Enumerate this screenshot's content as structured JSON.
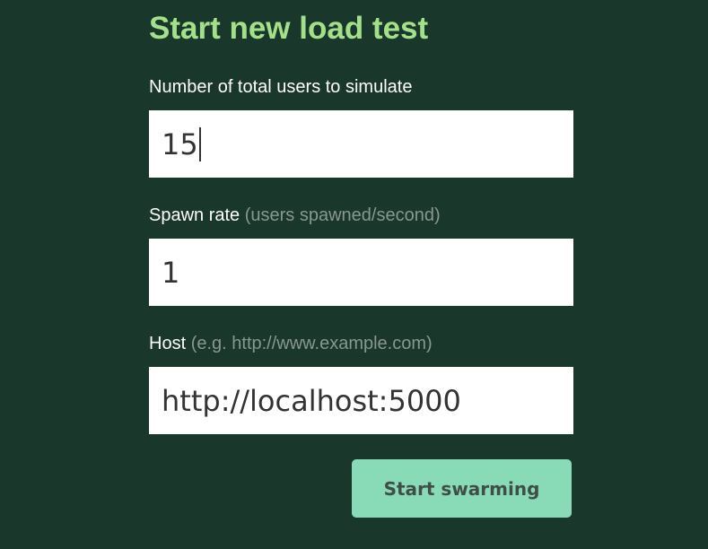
{
  "form": {
    "title": "Start new load test",
    "users": {
      "label": "Number of total users to simulate",
      "value": "15"
    },
    "spawn_rate": {
      "label": "Spawn rate",
      "hint": "(users spawned/second)",
      "value": "1"
    },
    "host": {
      "label": "Host",
      "hint": "(e.g. http://www.example.com)",
      "value": "http://localhost:5000"
    },
    "submit_label": "Start swarming"
  },
  "colors": {
    "background": "#1a372c",
    "title": "#a4e08a",
    "hint": "#8a978f",
    "button": "#89dbb8"
  }
}
